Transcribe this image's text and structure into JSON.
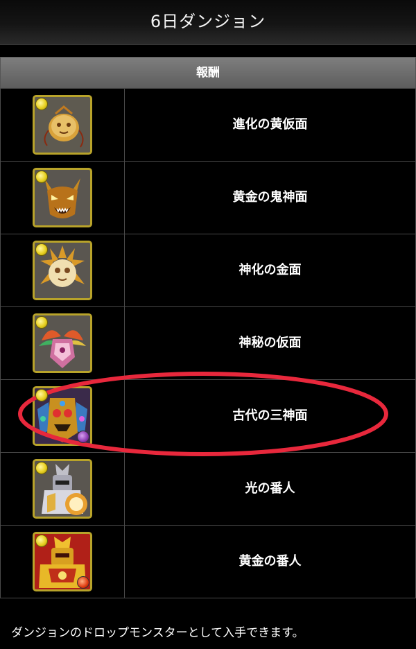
{
  "header": {
    "title": "6日ダンジョン"
  },
  "table": {
    "column_header": "報酬",
    "rows": [
      {
        "name": "進化の黄仮面",
        "icon": "yellow-mask-icon",
        "attribute": "light"
      },
      {
        "name": "黄金の鬼神面",
        "icon": "golden-demon-mask-icon",
        "attribute": "light"
      },
      {
        "name": "神化の金面",
        "icon": "golden-sun-mask-icon",
        "attribute": "light"
      },
      {
        "name": "神秘の仮面",
        "icon": "mystic-mask-icon",
        "attribute": "light"
      },
      {
        "name": "古代の三神面",
        "icon": "ancient-three-god-mask-icon",
        "attribute": "light",
        "sub_attribute": "dark",
        "highlighted": true
      },
      {
        "name": "光の番人",
        "icon": "light-guardian-icon",
        "attribute": "light"
      },
      {
        "name": "黄金の番人",
        "icon": "golden-guardian-icon",
        "attribute": "light",
        "sub_attribute": "fire"
      }
    ]
  },
  "footer": {
    "note": "ダンジョンのドロップモンスターとして入手できます。"
  },
  "colors": {
    "background": "#000000",
    "header_bar": "#7e7e7e",
    "highlight_circle": "#e8283c",
    "light_attribute": "#e8d020",
    "frame_gold": "#b8a32a"
  }
}
